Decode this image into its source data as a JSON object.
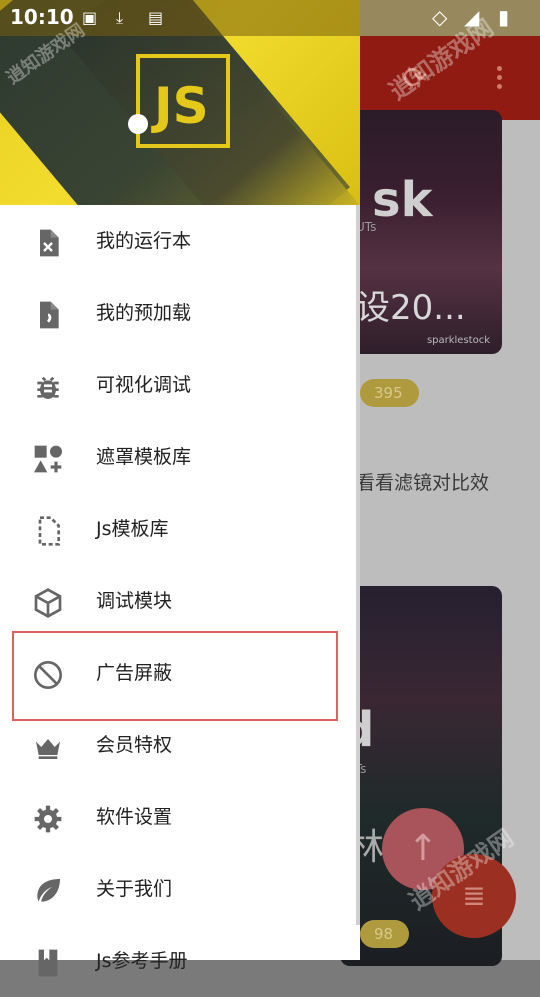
{
  "status_bar": {
    "time": "10:10"
  },
  "background": {
    "card1": {
      "big": "sk",
      "small": "UTs",
      "sub": "设20...",
      "brand": "sparklestock"
    },
    "pill1": "395",
    "text_line": "看看滤镜对比效",
    "card2": {
      "big": "d",
      "small": "UTs",
      "big2": "林"
    },
    "pill2": "98"
  },
  "drawer": {
    "header": {
      "logo_text": "JS"
    },
    "items": [
      {
        "label": "我的运行本",
        "icon": "file-x-icon"
      },
      {
        "label": "我的预加载",
        "icon": "file-comma-icon"
      },
      {
        "label": "可视化调试",
        "icon": "bug-icon"
      },
      {
        "label": "遮罩模板库",
        "icon": "shapes-icon"
      },
      {
        "label": "Js模板库",
        "icon": "dashed-file-icon"
      },
      {
        "label": "调试模块",
        "icon": "cube-icon"
      },
      {
        "label": "广告屏蔽",
        "icon": "block-icon"
      },
      {
        "label": "会员特权",
        "icon": "crown-icon"
      },
      {
        "label": "软件设置",
        "icon": "gear-icon"
      },
      {
        "label": "关于我们",
        "icon": "leaf-icon"
      },
      {
        "label": "Js参考手册",
        "icon": "book-icon"
      }
    ]
  },
  "watermark": "逍知游戏网"
}
